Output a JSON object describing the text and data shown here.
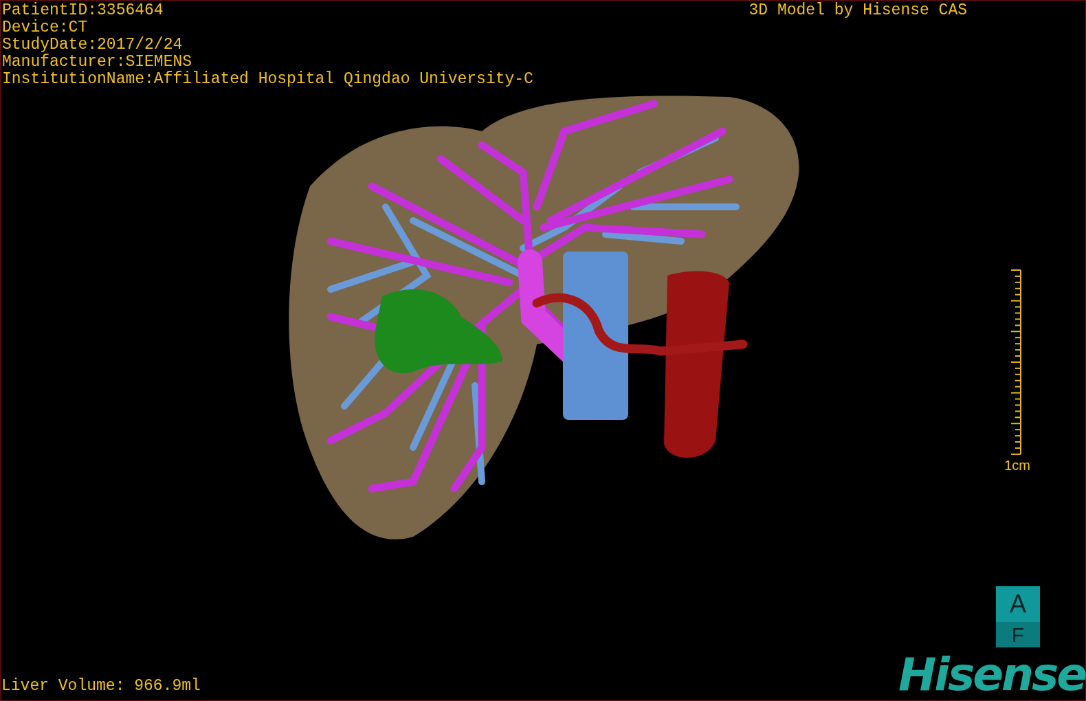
{
  "info_lines": [
    "PatientID:3356464",
    "Device:CT",
    "StudyDate:2017/2/24",
    "Manufacturer:SIEMENS",
    "InstitutionName:Affiliated Hospital Qingdao University-C"
  ],
  "title": "3D Model by Hisense CAS",
  "scale": {
    "label": "1cm"
  },
  "orientation": {
    "top": "A",
    "bottom": "F"
  },
  "liver_volume": "Liver Volume: 966.9ml",
  "logo": "Hisense"
}
